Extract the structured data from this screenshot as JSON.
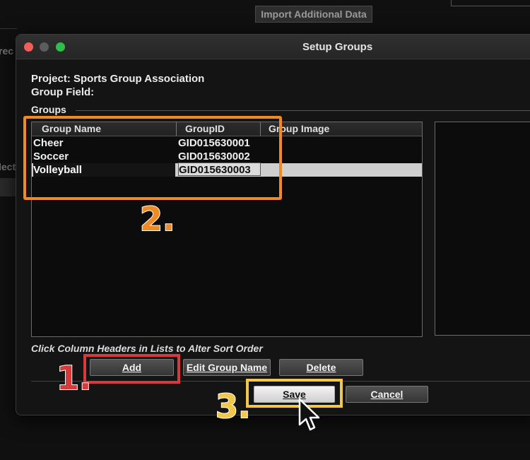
{
  "background_app": {
    "import_button_label": "Import Additional Data",
    "fragment_1": "rec",
    "fragment_2": "lect"
  },
  "dialog": {
    "title": "Setup Groups",
    "project_label": "Project: Sports Group Association",
    "group_field_label": "Group Field:",
    "groups_section_label": "Groups",
    "table": {
      "headers": [
        "Group Name",
        "GroupID",
        "Group Image"
      ],
      "rows": [
        {
          "name": "Cheer",
          "id": "GID015630001",
          "image": ""
        },
        {
          "name": "Soccer",
          "id": "GID015630002",
          "image": ""
        },
        {
          "name": "Volleyball",
          "id": "GID015630003",
          "image": ""
        }
      ],
      "selected_row": 2
    },
    "hint": "Click Column Headers in Lists to Alter Sort Order",
    "buttons": {
      "add": "Add",
      "edit_group_name": "Edit Group Name",
      "delete": "Delete",
      "save": "Save",
      "cancel": "Cancel"
    }
  },
  "annotations": {
    "step_1": "1.",
    "step_2": "2.",
    "step_3": "3.",
    "colors": {
      "step_1": "#d63a3a",
      "step_2": "#f08a22",
      "step_3": "#f2c84b"
    }
  },
  "icons": [
    "close-icon",
    "minimize-icon",
    "maximize-icon",
    "mouse-pointer-icon"
  ]
}
